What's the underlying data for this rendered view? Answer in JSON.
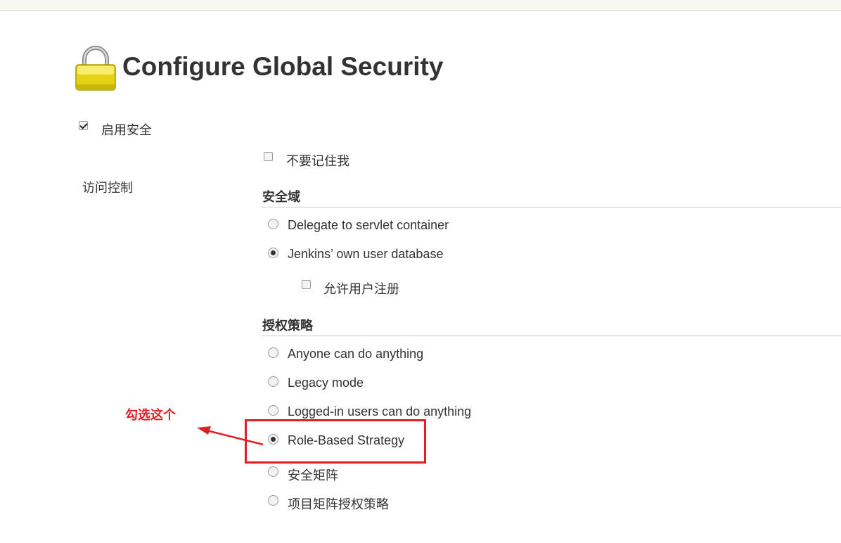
{
  "page": {
    "title": "Configure Global Security",
    "icon": "lock-icon"
  },
  "enable_security": {
    "label": "启用安全",
    "checked": true
  },
  "access_control": {
    "label": "访问控制",
    "remember_me": {
      "label": "不要记住我",
      "checked": false
    },
    "security_realm": {
      "title": "安全域",
      "options": [
        {
          "label": "Delegate to servlet container",
          "selected": false
        },
        {
          "label": "Jenkins’ own user database",
          "selected": true
        }
      ],
      "allow_signup": {
        "label": "允许用户注册",
        "checked": false
      }
    },
    "authorization": {
      "title": "授权策略",
      "options": [
        {
          "label": "Anyone can do anything",
          "selected": false
        },
        {
          "label": "Legacy mode",
          "selected": false
        },
        {
          "label": "Logged-in users can do anything",
          "selected": false
        },
        {
          "label": "Role-Based Strategy",
          "selected": true
        },
        {
          "label": "安全矩阵",
          "selected": false
        },
        {
          "label": "项目矩阵授权策略",
          "selected": false
        }
      ]
    }
  },
  "annotation": {
    "text": "勾选这个",
    "color": "#e02026"
  }
}
